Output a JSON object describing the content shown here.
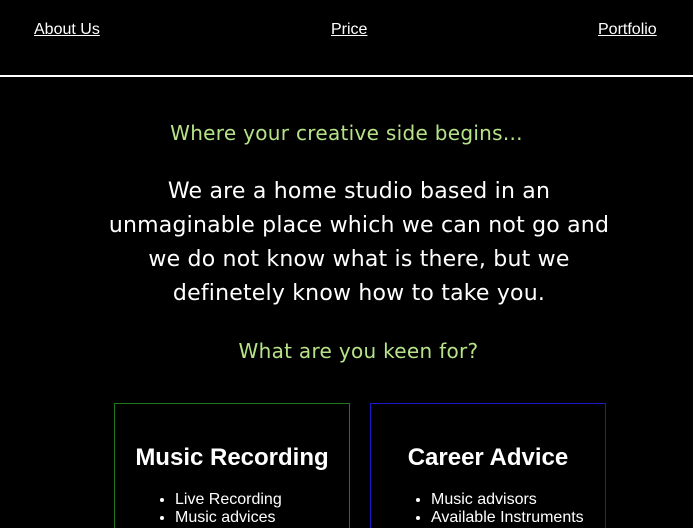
{
  "nav": {
    "about": "About Us",
    "price": "Price",
    "portfolio": "Portfolio"
  },
  "hero": {
    "tagline": "Where your creative side begins...",
    "intro": "We are a home studio based in an unmaginable place which we can not go and we do not know what is there, but we definetely know how to take you.",
    "question": "What are you keen for?"
  },
  "cards": [
    {
      "title": "Music Recording",
      "items": [
        "Live Recording",
        "Music advices"
      ]
    },
    {
      "title": "Career Advice",
      "items": [
        "Music advisors",
        "Available Instruments"
      ]
    }
  ],
  "colors": {
    "background": "#000000",
    "accent": "#b6e388",
    "text": "#ffffff",
    "card_recording_border": "#1f7a1f",
    "card_career_border": "#1a1acc"
  }
}
